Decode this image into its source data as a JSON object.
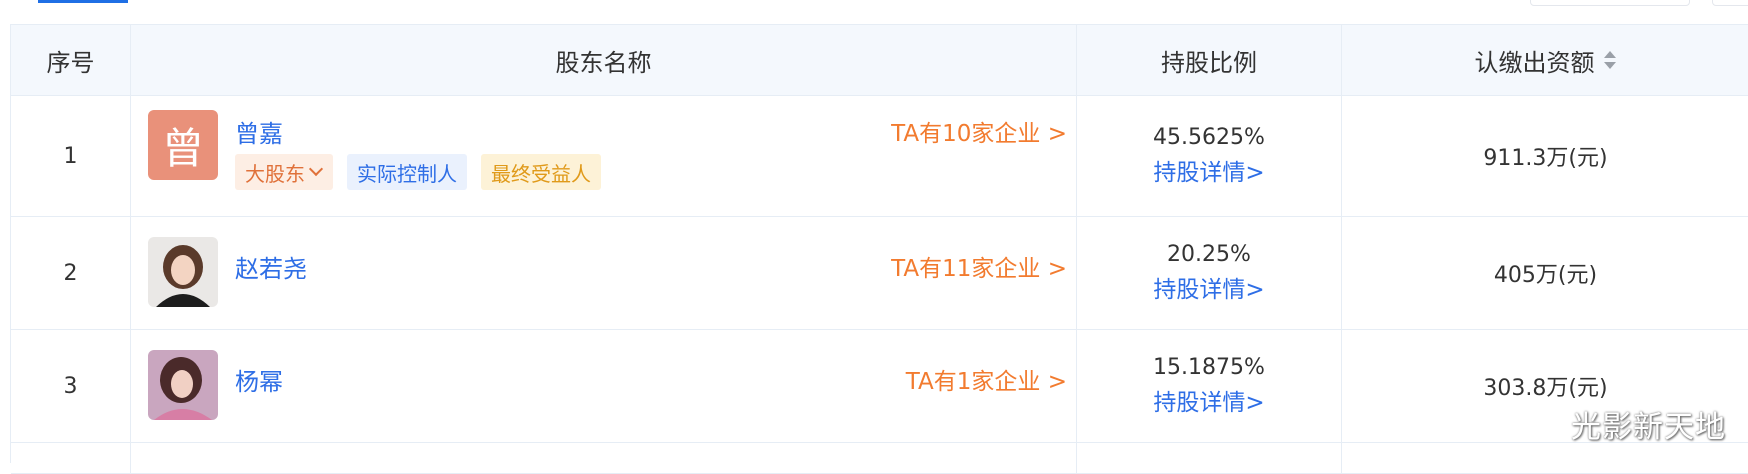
{
  "header": {
    "index": "序号",
    "name": "股东名称",
    "ratio": "持股比例",
    "amount": "认缴出资额",
    "amount_sort_icon": "sort-up-down-icon"
  },
  "rows": [
    {
      "index": "1",
      "avatar_text": "曾",
      "name": "曾嘉",
      "enterprises": "TA有10家企业 >",
      "tags": [
        "大股东",
        "实际控制人",
        "最终受益人"
      ],
      "ratio": "45.5625%",
      "detail": "持股详情>",
      "amount": "911.3万(元)"
    },
    {
      "index": "2",
      "name": "赵若尧",
      "enterprises": "TA有11家企业 >",
      "ratio": "20.25%",
      "detail": "持股详情>",
      "amount": "405万(元)"
    },
    {
      "index": "3",
      "name": "杨幂",
      "enterprises": "TA有1家企业 >",
      "ratio": "15.1875%",
      "detail": "持股详情>",
      "amount": "303.8万(元)"
    }
  ],
  "watermark": "光影新天地",
  "colors": {
    "link_blue": "#2e6ee6",
    "link_orange": "#f27b2f",
    "header_bg": "#f4f8fd",
    "avatar_orange": "#e9917a"
  }
}
